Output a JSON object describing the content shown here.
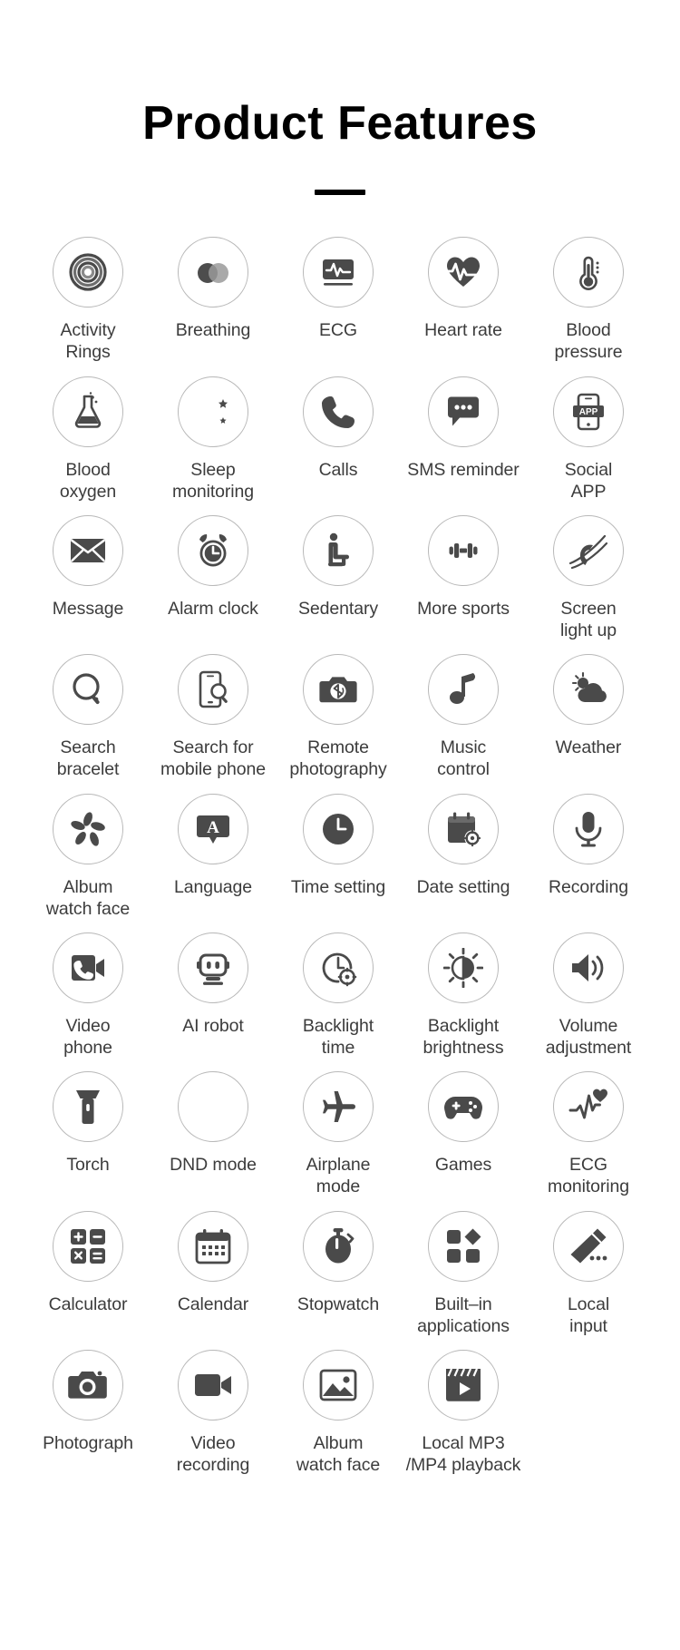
{
  "header": {
    "title": "Product Features",
    "divider": true
  },
  "features": [
    [
      {
        "label": "Activity\nRings",
        "icon": "activity-rings-icon"
      },
      {
        "label": "Breathing",
        "icon": "breathing-icon"
      },
      {
        "label": "ECG",
        "icon": "ecg-monitor-icon"
      },
      {
        "label": "Heart rate",
        "icon": "heart-rate-icon"
      },
      {
        "label": "Blood\npressure",
        "icon": "thermometer-icon"
      }
    ],
    [
      {
        "label": "Blood\noxygen",
        "icon": "flask-icon"
      },
      {
        "label": "Sleep\nmonitoring",
        "icon": "moon-stars-icon"
      },
      {
        "label": "Calls",
        "icon": "phone-icon"
      },
      {
        "label": "SMS reminder",
        "icon": "sms-bubble-icon"
      },
      {
        "label": "Social\nAPP",
        "icon": "social-app-icon"
      }
    ],
    [
      {
        "label": "Message",
        "icon": "envelope-icon"
      },
      {
        "label": "Alarm clock",
        "icon": "alarm-clock-icon"
      },
      {
        "label": "Sedentary",
        "icon": "sedentary-icon"
      },
      {
        "label": "More sports",
        "icon": "dumbbell-icon"
      },
      {
        "label": "Screen\nlight up",
        "icon": "wrist-raise-icon"
      }
    ],
    [
      {
        "label": "Search\nbracelet",
        "icon": "search-bracelet-icon"
      },
      {
        "label": "Search for\nmobile phone",
        "icon": "search-phone-icon"
      },
      {
        "label": "Remote\nphotography",
        "icon": "remote-camera-icon"
      },
      {
        "label": "Music\ncontrol",
        "icon": "music-note-icon"
      },
      {
        "label": "Weather",
        "icon": "weather-icon"
      }
    ],
    [
      {
        "label": "Album\nwatch face",
        "icon": "pinwheel-icon"
      },
      {
        "label": "Language",
        "icon": "language-icon"
      },
      {
        "label": "Time setting",
        "icon": "clock-icon"
      },
      {
        "label": "Date setting",
        "icon": "date-setting-icon"
      },
      {
        "label": "Recording",
        "icon": "microphone-icon"
      }
    ],
    [
      {
        "label": "Video\nphone",
        "icon": "video-phone-icon"
      },
      {
        "label": "AI robot",
        "icon": "ai-robot-icon"
      },
      {
        "label": "Backlight\ntime",
        "icon": "backlight-time-icon"
      },
      {
        "label": "Backlight\nbrightness",
        "icon": "brightness-icon"
      },
      {
        "label": "Volume\nadjustment",
        "icon": "volume-icon"
      }
    ],
    [
      {
        "label": "Torch",
        "icon": "torch-icon"
      },
      {
        "label": "DND mode",
        "icon": "dnd-moon-icon"
      },
      {
        "label": "Airplane\nmode",
        "icon": "airplane-icon"
      },
      {
        "label": "Games",
        "icon": "gamepad-icon"
      },
      {
        "label": "ECG\nmonitoring",
        "icon": "ecg-wave-heart-icon"
      }
    ],
    [
      {
        "label": "Calculator",
        "icon": "calculator-icon"
      },
      {
        "label": "Calendar",
        "icon": "calendar-icon"
      },
      {
        "label": "Stopwatch",
        "icon": "stopwatch-icon"
      },
      {
        "label": "Built–in\napplications",
        "icon": "built-in-apps-icon"
      },
      {
        "label": "Local\ninput",
        "icon": "pencil-input-icon"
      }
    ],
    [
      {
        "label": "Photograph",
        "icon": "camera-icon"
      },
      {
        "label": "Video\nrecording",
        "icon": "video-camera-icon"
      },
      {
        "label": "Album\nwatch face",
        "icon": "photo-album-icon"
      },
      {
        "label": "Local MP3\n/MP4 playback",
        "icon": "clapperboard-play-icon"
      }
    ]
  ],
  "colors": {
    "background": "#ffffff",
    "title": "#000000",
    "label": "#3c3c3c",
    "icon": "#4a4a4a",
    "circle_border": "#b8b8b8"
  }
}
